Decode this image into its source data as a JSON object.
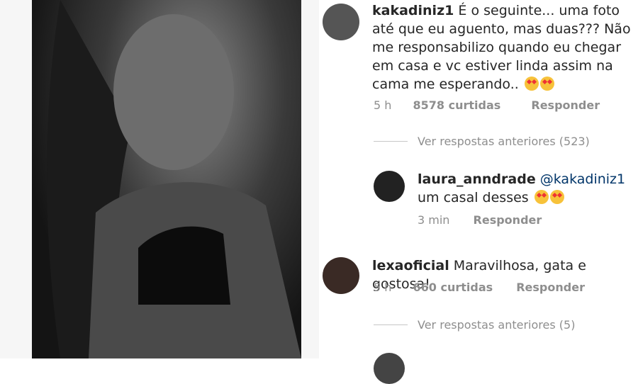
{
  "comments": [
    {
      "username": "kakadiniz1",
      "text": "É o seguinte... uma foto até que eu aguento, mas duas??? Não me responsabilizo quando eu chegar em casa e vc estiver linda assim na cama me esperando..",
      "time": "5 h",
      "likes": "8578 curtidas",
      "reply": "Responder"
    },
    {
      "view_more": "Ver respostas anteriores (523)"
    },
    {
      "username": "laura_anndrade",
      "mention": "@kakadiniz1",
      "text": "um casal desses",
      "time": "3 min",
      "reply": "Responder"
    },
    {
      "username": "lexaoficial",
      "text": "Maravilhosa, gata e gostosa!",
      "time": "5 h",
      "likes": "660 curtidas",
      "reply": "Responder"
    },
    {
      "view_more": "Ver respostas anteriores (5)"
    }
  ],
  "emoji": "heart-eyes-emoji"
}
